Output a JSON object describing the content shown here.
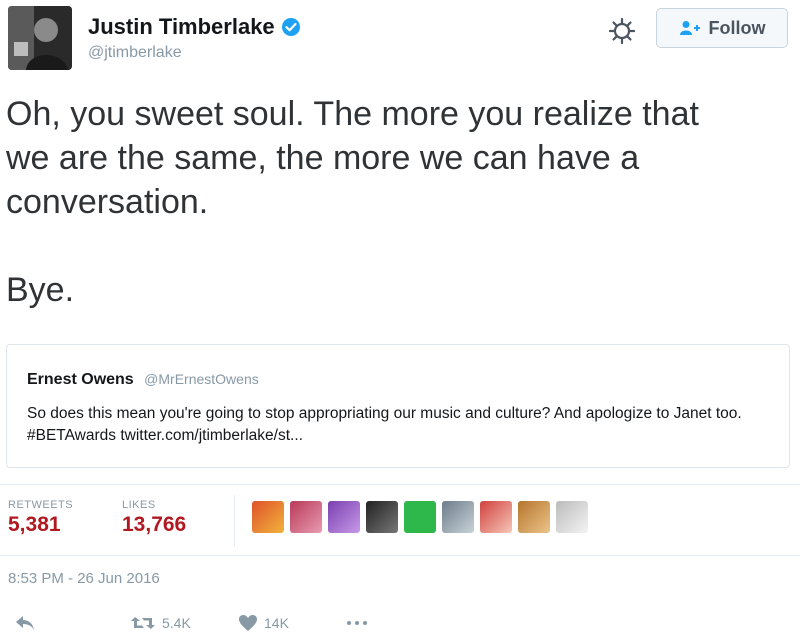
{
  "tweet": {
    "author": {
      "name": "Justin Timberlake",
      "handle": "@jtimberlake",
      "verified": true
    },
    "follow_label": "Follow",
    "text": "Oh, you sweet soul. The more you realize that\nwe are the same, the more we can have a\nconversation.\n\nBye.",
    "quoted": {
      "name": "Ernest Owens",
      "handle": "@MrErnestOwens",
      "text": "So does this mean you're going to stop appropriating our music and culture? And apologize to Janet too. #BETAwards twitter.com/jtimberlake/st..."
    },
    "stats": {
      "retweets_label": "RETWEETS",
      "retweets": "5,381",
      "likes_label": "LIKES",
      "likes": "13,766"
    },
    "timestamp": "8:53 PM - 26 Jun 2016",
    "actions": {
      "retweet_count": "5.4K",
      "like_count": "14K"
    }
  },
  "colors": {
    "stat_value": "#b0191f",
    "muted": "#8899a6",
    "verified": "#1da1f2"
  },
  "icons": [
    "verified-badge-icon",
    "gear-icon",
    "follow-person-icon",
    "reply-icon",
    "retweet-icon",
    "heart-icon",
    "more-icon"
  ]
}
